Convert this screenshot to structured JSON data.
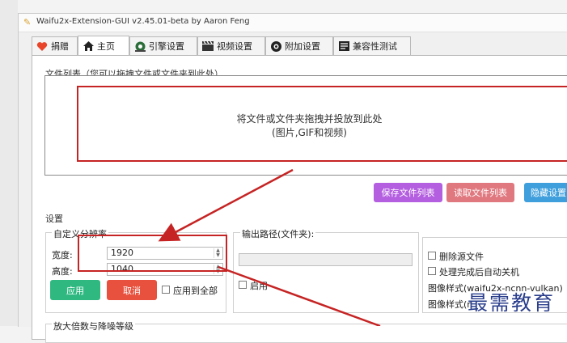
{
  "window": {
    "title": "Waifu2x-Extension-GUI v2.45.01-beta by Aaron Feng"
  },
  "tabs": [
    {
      "label": "捐赠",
      "icon": "heart-icon",
      "color": "#e8452b"
    },
    {
      "label": "主页",
      "icon": "home-icon",
      "color": "#222222"
    },
    {
      "label": "引擎设置",
      "icon": "engine-icon",
      "color": "#2c6e3a"
    },
    {
      "label": "视频设置",
      "icon": "clapper-icon",
      "color": "#333333"
    },
    {
      "label": "附加设置",
      "icon": "gear-icon",
      "color": "#222222"
    },
    {
      "label": "兼容性测试",
      "icon": "checklist-icon",
      "color": "#222222"
    }
  ],
  "file_list": {
    "group_title": "文件列表（您可以拖拽文件或文件夹到此处）",
    "drop_hint_line1": "将文件或文件夹拖拽并投放到此处",
    "drop_hint_line2": "(图片,GIF和视频)"
  },
  "list_buttons": {
    "save": "保存文件列表",
    "load": "读取文件列表",
    "hide": "隐藏设置"
  },
  "settings": {
    "group_title": "设置",
    "custom_res": {
      "title": "自定义分辨率",
      "width_label": "宽度:",
      "width_value": "1920",
      "height_label": "高度:",
      "height_value": "1040",
      "apply": "应用",
      "cancel": "取消",
      "apply_all": "应用到全部"
    },
    "output_path": {
      "title": "输出路径(文件夹):",
      "enable": "启用"
    },
    "options": {
      "delete_source": "删除源文件",
      "shutdown_after": "处理完成后自动关机",
      "image_style_1": "图像样式(waifu2x-ncnn-vulkan)",
      "image_style_2": "图像样式(r"
    },
    "scale_group_title": "放大倍数与降噪等级"
  },
  "watermark": "最需教育",
  "colors": {
    "purple": "#b45ee0",
    "rose": "#e0787f",
    "blue": "#3f9fdd",
    "green": "#2fb981",
    "red": "#e8513d",
    "annotation_red": "#c62424"
  }
}
